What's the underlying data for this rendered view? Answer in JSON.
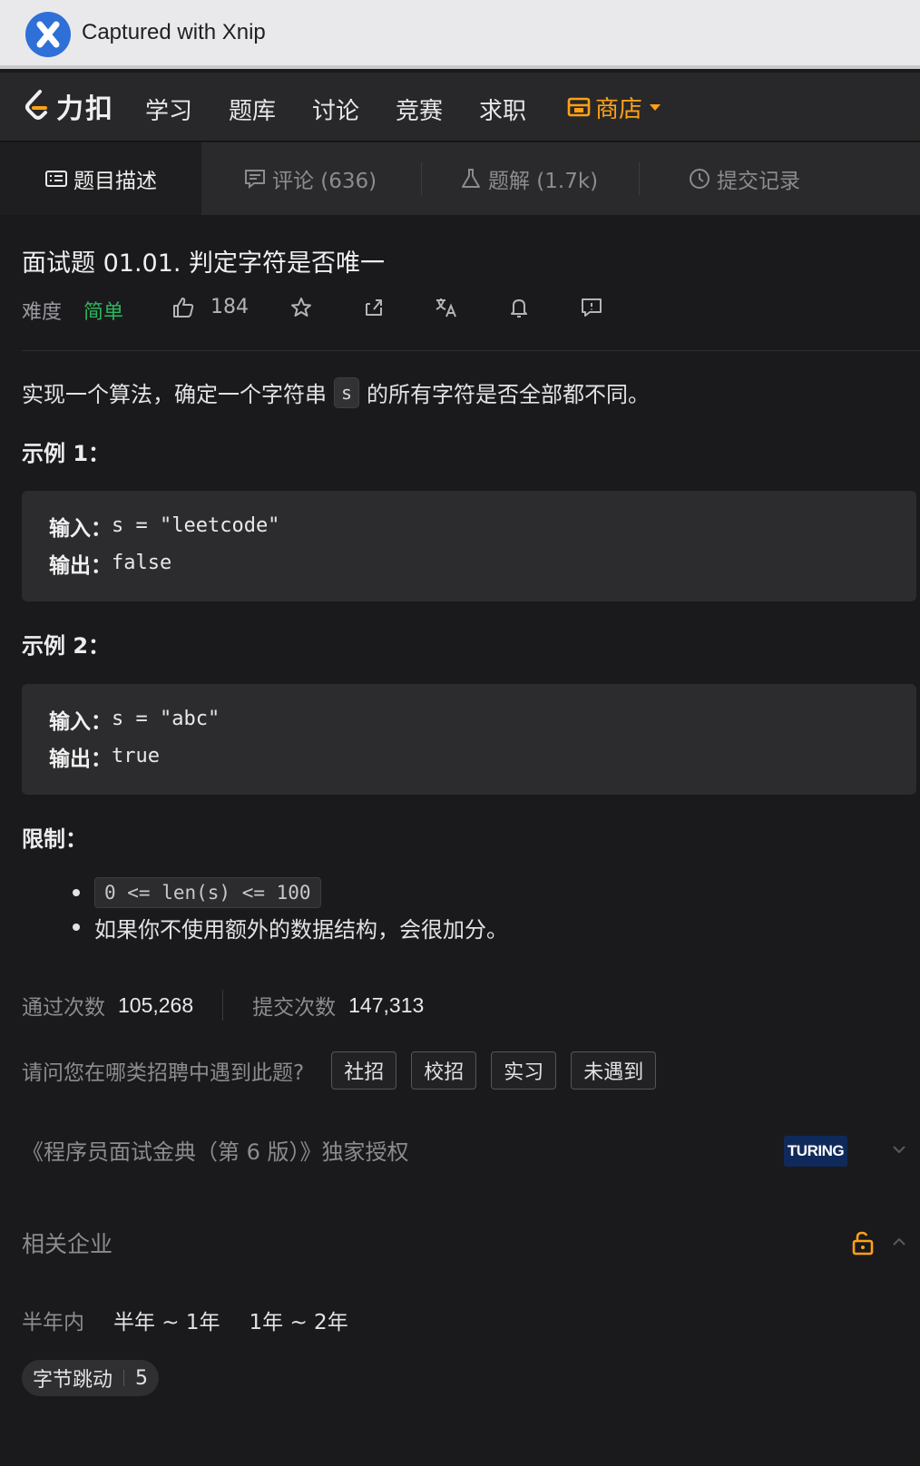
{
  "capture_bar": {
    "text": "Captured with Xnip",
    "icon": "xnip-logo-icon"
  },
  "nav": {
    "brand": "力扣",
    "items": [
      "学习",
      "题库",
      "讨论",
      "竞赛",
      "求职"
    ],
    "shop": "商店",
    "accent": "#ffa116"
  },
  "tabs": {
    "description": "题目描述",
    "comments": "评论 (636)",
    "solutions": "题解 (1.7k)",
    "submissions": "提交记录"
  },
  "problem": {
    "title": "面试题 01.01. 判定字符是否唯一",
    "difficulty_label": "难度",
    "difficulty": "简单",
    "difficulty_color": "#2db55d",
    "likes": "184",
    "desc_before": "实现一个算法，确定一个字符串",
    "desc_code": "s",
    "desc_after": "的所有字符是否全部都不同。",
    "examples": [
      {
        "heading": "示例 1：",
        "input_label": "输入：",
        "input": "s = \"leetcode\"",
        "output_label": "输出：",
        "output": "false"
      },
      {
        "heading": "示例 2：",
        "input_label": "输入：",
        "input": "s = \"abc\"",
        "output_label": "输出：",
        "output": "true"
      }
    ],
    "limits_heading": "限制：",
    "limits": [
      "0 <= len(s) <= 100",
      "如果你不使用额外的数据结构，会很加分。"
    ]
  },
  "stats": {
    "accepted_label": "通过次数",
    "accepted": "105,268",
    "submitted_label": "提交次数",
    "submitted": "147,313"
  },
  "survey": {
    "question": "请问您在哪类招聘中遇到此题?",
    "options": [
      "社招",
      "校招",
      "实习",
      "未遇到"
    ]
  },
  "book": {
    "text": "《程序员面试金典（第 6 版）》独家授权",
    "publisher_logo": "TURING"
  },
  "companies": {
    "heading": "相关企业",
    "periods": [
      "半年内",
      "半年 ~ 1年",
      "1年 ~ 2年"
    ],
    "tags": [
      {
        "name": "字节跳动",
        "count": "5"
      }
    ]
  }
}
